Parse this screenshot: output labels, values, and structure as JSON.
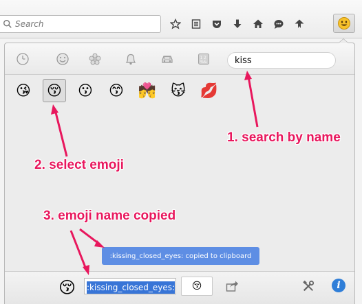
{
  "browser": {
    "search": {
      "placeholder": "Search",
      "value": ""
    },
    "toolbar_icons": [
      "star-icon",
      "reading-list-icon",
      "pocket-icon",
      "download-icon",
      "home-icon",
      "chat-icon",
      "hello-icon",
      "emoji-icon"
    ]
  },
  "panel": {
    "categories": [
      "clock-icon",
      "smiley-icon",
      "flower-icon",
      "bell-icon",
      "car-icon",
      "symbols-icon"
    ],
    "search_value": "kiss",
    "emojis": [
      {
        "name": "face-throwing-kiss",
        "glyph": "😘"
      },
      {
        "name": "kissing-closed-eyes",
        "glyph": "😚",
        "selected": true
      },
      {
        "name": "kissing-face",
        "glyph": "😗"
      },
      {
        "name": "kissing-smiling-eyes",
        "glyph": "😙"
      },
      {
        "name": "kiss-couple",
        "glyph": "💏"
      },
      {
        "name": "kissing-cat",
        "glyph": "😽"
      },
      {
        "name": "kiss-mark",
        "glyph": "💋"
      }
    ],
    "tooltip": ":kissing_closed_eyes: copied to clipboard",
    "preview_glyph": "😚",
    "name_field": ":kissing_closed_eyes:",
    "code_glyph": "😚"
  },
  "annotations": {
    "step1": "1. search by name",
    "step2": "2. select emoji",
    "step3": "3. emoji name copied"
  },
  "colors": {
    "annotation": "#e8175d",
    "tooltip_bg": "#5e8ee4",
    "selection": "#3875d7",
    "info": "#2f7ed8"
  }
}
